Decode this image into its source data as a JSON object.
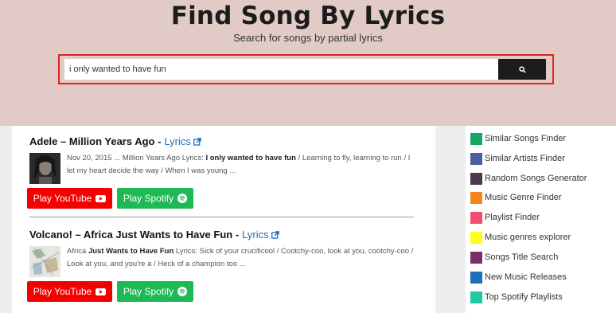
{
  "hero": {
    "title": "Find Song By Lyrics",
    "subtitle": "Search for songs by partial lyrics"
  },
  "search": {
    "value": "i only wanted to have fun",
    "button_icon": "search-icon"
  },
  "results": [
    {
      "title": "Adele – Million Years Ago -",
      "lyrics_label": "Lyrics",
      "snippet_pre": "Nov 20, 2015 ... Million Years Ago Lyrics: ",
      "snippet_bold": "I only wanted to have fun",
      "snippet_post": " / Learning to fly, learning to run / I let my heart decide the way / When I was young ...",
      "youtube_label": "Play YouTube",
      "spotify_label": "Play Spotify"
    },
    {
      "title": "Volcano! – Africa Just Wants to Have Fun -",
      "lyrics_label": "Lyrics",
      "snippet_pre": "Africa ",
      "snippet_bold": "Just Wants to Have Fun",
      "snippet_post": " Lyrics: Sick of your crucificool / Cootchy-coo, look at you, cootchy-coo / Look at you, and you're a / Heck of a champion too ...",
      "youtube_label": "Play YouTube",
      "spotify_label": "Play Spotify"
    }
  ],
  "sidebar": {
    "items": [
      {
        "label": "Similar Songs Finder",
        "color": "#16a765"
      },
      {
        "label": "Similar Artists Finder",
        "color": "#4a5fa0"
      },
      {
        "label": "Random Songs Generator",
        "color": "#4a3b4c"
      },
      {
        "label": "Music Genre Finder",
        "color": "#f5841f"
      },
      {
        "label": "Playlist Finder",
        "color": "#f04e6e"
      },
      {
        "label": "Music genres explorer",
        "color": "#ffff1a"
      },
      {
        "label": "Songs Title Search",
        "color": "#7b2d6a"
      },
      {
        "label": "New Music Releases",
        "color": "#1b6fb8"
      },
      {
        "label": "Top Spotify Playlists",
        "color": "#1ec9a3"
      }
    ]
  },
  "colors": {
    "hero_bg": "#e2cbc6",
    "search_border": "#e02424",
    "youtube": "#f40000",
    "spotify": "#1db954",
    "link": "#1f6fc0"
  }
}
